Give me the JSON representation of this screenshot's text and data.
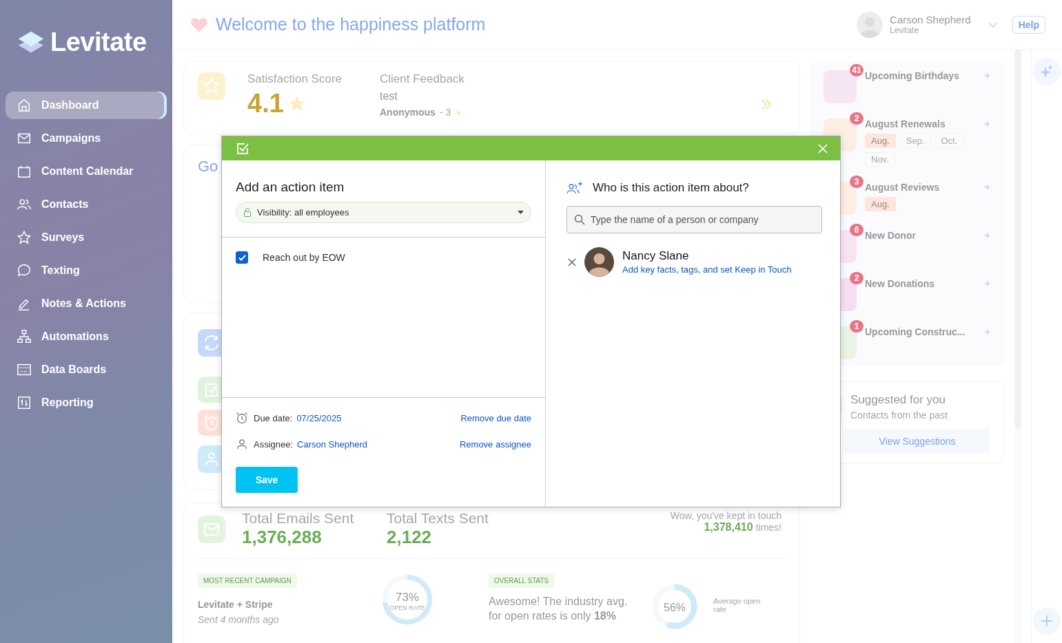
{
  "sidebar": {
    "logo": "Levitate",
    "items": [
      {
        "label": "Dashboard",
        "selected": true
      },
      {
        "label": "Campaigns",
        "selected": false
      },
      {
        "label": "Content Calendar",
        "selected": false
      },
      {
        "label": "Contacts",
        "selected": false
      },
      {
        "label": "Surveys",
        "selected": false
      },
      {
        "label": "Texting",
        "selected": false
      },
      {
        "label": "Notes & Actions",
        "selected": false
      },
      {
        "label": "Automations",
        "selected": false
      },
      {
        "label": "Data Boards",
        "selected": false
      },
      {
        "label": "Reporting",
        "selected": false
      }
    ]
  },
  "header": {
    "title": "Welcome to the happiness platform",
    "user": {
      "name": "Carson Shepherd",
      "org": "Levitate"
    },
    "help": "Help"
  },
  "satisfaction": {
    "label": "Satisfaction Score",
    "score": "4.1",
    "feedback_label": "Client Feedback",
    "feedback_text": "test",
    "feedback_author": "Anonymous",
    "feedback_rating": "- 3"
  },
  "integrations_card": {
    "logo_text": "Go"
  },
  "stats": {
    "emails_label": "Total Emails Sent",
    "emails": "1,376,288",
    "texts_label": "Total Texts Sent",
    "texts": "2,122",
    "touch_text": "Wow, you've kept in touch",
    "touch_count": "1,378,410",
    "touch_suffix": "times!",
    "campaign": {
      "tag": "MOST RECENT CAMPAIGN",
      "name": "Levitate + Stripe",
      "sent": "Sent 4 months ago",
      "level": 0.73,
      "reading": "73%",
      "caption": "OPEN RATE"
    },
    "overall": {
      "tag": "OVERALL STATS",
      "text": "Awesome! The industry avg. for open rates is only **18%**",
      "level": 0.56,
      "reading": "56%",
      "caption": "Average open rate"
    }
  },
  "reminders": [
    {
      "count": "41",
      "title": "Upcoming Birthdays",
      "color": "#f6e6f3"
    },
    {
      "count": "2",
      "title": "August Renewals",
      "color": "#fdeee4",
      "tags": [
        {
          "label": "Aug.",
          "selected": true
        },
        {
          "label": "Sep.",
          "selected": false
        },
        {
          "label": "Oct.",
          "selected": false
        },
        {
          "label": "Nov.",
          "selected": false
        }
      ]
    },
    {
      "count": "3",
      "title": "August Reviews",
      "color": "#fdeee4",
      "tags": [
        {
          "label": "Aug.",
          "selected": true
        }
      ]
    },
    {
      "count": "6",
      "title": "New Donor",
      "color": "#f8e3f3"
    },
    {
      "count": "2",
      "title": "New Donations",
      "color": "#f6def2"
    },
    {
      "count": "1",
      "title": "Upcoming Construc...",
      "color": "#e9f4e4"
    }
  ],
  "suggestions": {
    "title": "Suggested for you",
    "subtitle": "Contacts from the past",
    "button": "View Suggestions"
  },
  "modal": {
    "title": "Add an action item",
    "visibility": "Visibility: all employees",
    "task": {
      "text": "Reach out by EOW",
      "checked": true
    },
    "due_label": "Due date:",
    "due_value": "07/25/2025",
    "remove_due": "Remove due date",
    "assignee_label": "Assignee:",
    "assignee_value": "Carson Shepherd",
    "remove_assignee": "Remove assignee",
    "save": "Save",
    "about_title": "Who is this action item about?",
    "search_placeholder": "Type the name of a person or company",
    "contacts": [
      {
        "name": "Nancy Slane",
        "action": "Add key facts, tags, and set Keep in Touch"
      }
    ]
  }
}
